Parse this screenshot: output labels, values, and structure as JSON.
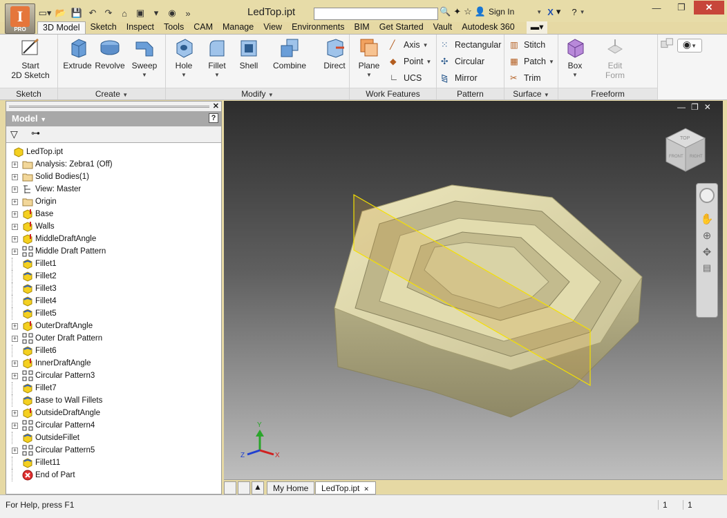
{
  "window": {
    "doc_title": "LedTop.ipt",
    "sign_in": "Sign In"
  },
  "app_button": {
    "letter": "I",
    "badge": "PRO"
  },
  "tabs": [
    "3D Model",
    "Sketch",
    "Inspect",
    "Tools",
    "CAM",
    "Manage",
    "View",
    "Environments",
    "BIM",
    "Get Started",
    "Vault",
    "Autodesk 360"
  ],
  "ribbon": {
    "sketch": {
      "panel": "Sketch",
      "start_l1": "Start",
      "start_l2": "2D Sketch"
    },
    "create": {
      "panel": "Create",
      "extrude": "Extrude",
      "revolve": "Revolve",
      "sweep": "Sweep"
    },
    "modify": {
      "panel": "Modify",
      "hole": "Hole",
      "fillet": "Fillet",
      "shell": "Shell",
      "combine": "Combine",
      "direct": "Direct"
    },
    "work": {
      "panel": "Work Features",
      "plane": "Plane",
      "axis": "Axis",
      "point": "Point",
      "ucs": "UCS"
    },
    "pattern": {
      "panel": "Pattern",
      "rectangular": "Rectangular",
      "circular": "Circular",
      "mirror": "Mirror"
    },
    "surface": {
      "panel": "Surface",
      "stitch": "Stitch",
      "patch": "Patch",
      "trim": "Trim"
    },
    "freeform": {
      "panel": "Freeform",
      "box": "Box",
      "edit_l1": "Edit",
      "edit_l2": "Form"
    }
  },
  "browser": {
    "title": "Model",
    "items": [
      {
        "label": "LedTop.ipt",
        "icon": "part-icon"
      },
      {
        "label": "Analysis: Zebra1 (Off)",
        "icon": "folder-icon"
      },
      {
        "label": "Solid Bodies(1)",
        "icon": "folder-icon"
      },
      {
        "label": "View: Master",
        "icon": "view-icon"
      },
      {
        "label": "Origin",
        "icon": "folder-icon"
      },
      {
        "label": "Base",
        "icon": "extrude-feature-icon"
      },
      {
        "label": "Walls",
        "icon": "extrude-feature-icon"
      },
      {
        "label": "MiddleDraftAngle",
        "icon": "extrude-feature-icon"
      },
      {
        "label": "Middle Draft Pattern",
        "icon": "pattern-icon"
      },
      {
        "label": "Fillet1",
        "icon": "fillet-icon"
      },
      {
        "label": "Fillet2",
        "icon": "fillet-icon"
      },
      {
        "label": "Fillet3",
        "icon": "fillet-icon"
      },
      {
        "label": "Fillet4",
        "icon": "fillet-icon"
      },
      {
        "label": "Fillet5",
        "icon": "fillet-icon"
      },
      {
        "label": "OuterDraftAngle",
        "icon": "extrude-feature-icon"
      },
      {
        "label": "Outer Draft Pattern",
        "icon": "pattern-icon"
      },
      {
        "label": "Fillet6",
        "icon": "fillet-icon"
      },
      {
        "label": "InnerDraftAngle",
        "icon": "extrude-feature-icon"
      },
      {
        "label": "Circular Pattern3",
        "icon": "pattern-icon"
      },
      {
        "label": "Fillet7",
        "icon": "fillet-icon"
      },
      {
        "label": "Base to Wall Fillets",
        "icon": "fillet-icon"
      },
      {
        "label": "OutsideDraftAngle",
        "icon": "extrude-feature-icon"
      },
      {
        "label": "Circular Pattern4",
        "icon": "pattern-icon"
      },
      {
        "label": "OutsideFillet",
        "icon": "fillet-icon"
      },
      {
        "label": "Circular Pattern5",
        "icon": "pattern-icon"
      },
      {
        "label": "Fillet11",
        "icon": "fillet-icon"
      },
      {
        "label": "End of Part",
        "icon": "end-of-part-icon"
      }
    ]
  },
  "viewcube": {
    "top": "TOP",
    "front": "FRONT",
    "right": "RIGHT"
  },
  "triad": {
    "x": "X",
    "y": "Y",
    "z": "Z"
  },
  "doc_tabs": [
    "My Home",
    "LedTop.ipt"
  ],
  "status": {
    "help": "For Help, press F1",
    "count1": "1",
    "count2": "1"
  }
}
